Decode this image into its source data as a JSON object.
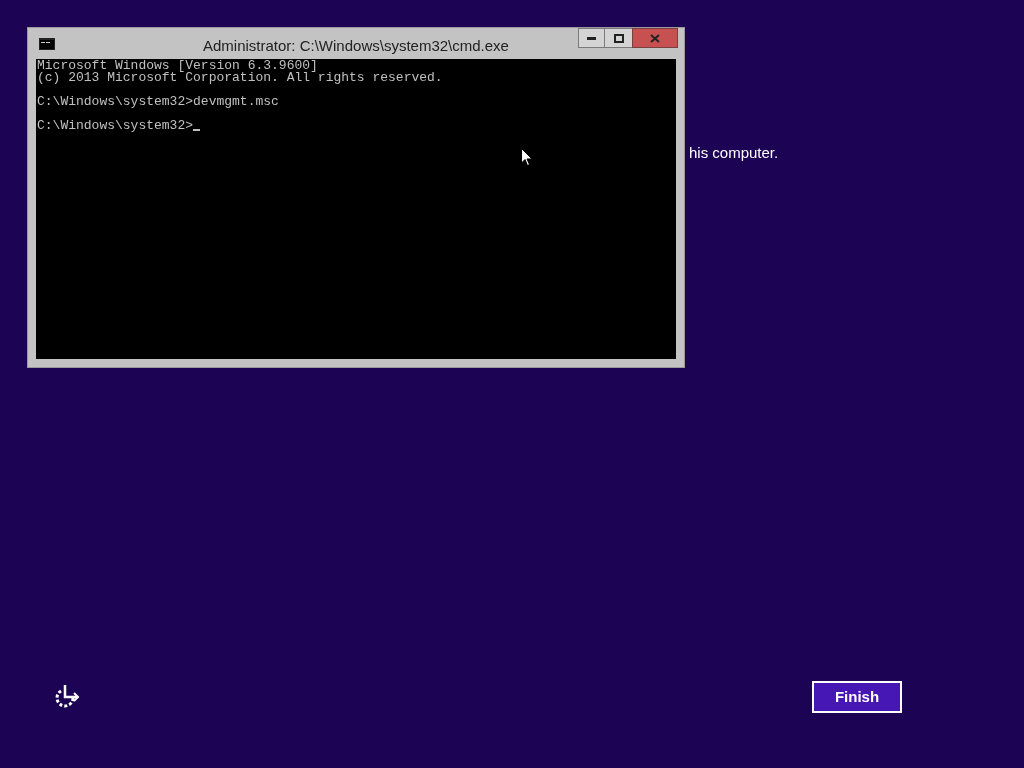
{
  "background_text": "his computer.",
  "console_window": {
    "title": "Administrator: C:\\Windows\\system32\\cmd.exe",
    "blocks": [
      [
        "Microsoft Windows [Version 6.3.9600]",
        "(c) 2013 Microsoft Corporation. All rights reserved."
      ],
      [
        "C:\\Windows\\system32>devmgmt.msc"
      ],
      [
        "C:\\Windows\\system32>"
      ]
    ],
    "caret_visible": true
  },
  "finish_button": {
    "label": "Finish"
  }
}
